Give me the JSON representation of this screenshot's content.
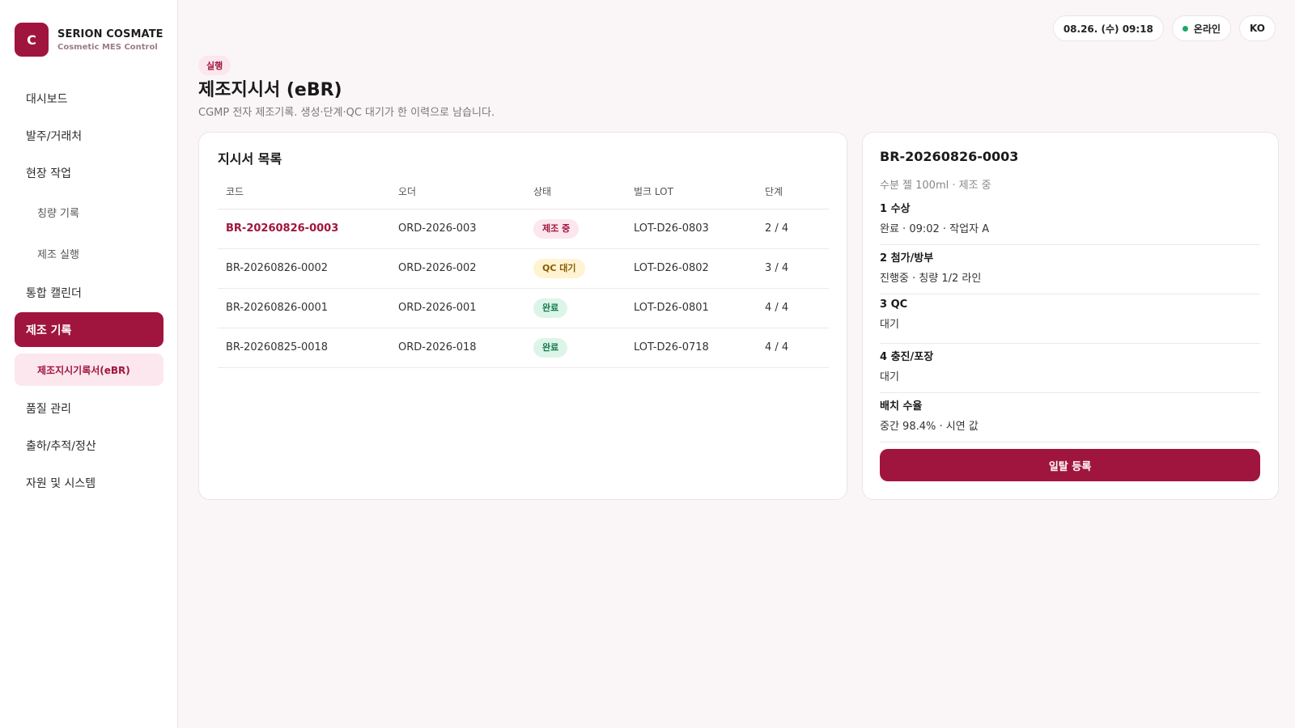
{
  "brand": {
    "logo_letter": "C",
    "name": "SERION COSMATE",
    "sub": "Cosmetic MES Control"
  },
  "sidebar": {
    "items": [
      {
        "label": "대시보드"
      },
      {
        "label": "발주/거래처"
      },
      {
        "label": "현장 작업"
      },
      {
        "label": "칭량 기록"
      },
      {
        "label": "제조 실행"
      },
      {
        "label": "통합 캘린더"
      },
      {
        "label": "제조 기록"
      },
      {
        "label": "제조지시기록서(eBR)"
      },
      {
        "label": "품질 관리"
      },
      {
        "label": "출하/추적/정산"
      },
      {
        "label": "자원 및 시스템"
      }
    ]
  },
  "topbar": {
    "datetime": "08.26. (수) 09:18",
    "status": "온라인",
    "lang": "KO"
  },
  "header": {
    "tag": "실행",
    "title": "제조지시서 (eBR)",
    "subtitle": "CGMP 전자 제조기록. 생성·단계·QC 대기가 한 이력으로 남습니다."
  },
  "list": {
    "title": "지시서 목록",
    "columns": [
      "코드",
      "오더",
      "상태",
      "벌크 LOT",
      "단계"
    ],
    "rows": [
      {
        "code": "BR-20260826-0003",
        "order": "ORD-2026-003",
        "status": "제조 중",
        "lot": "LOT-D26-0803",
        "step": "2 / 4"
      },
      {
        "code": "BR-20260826-0002",
        "order": "ORD-2026-002",
        "status": "QC 대기",
        "lot": "LOT-D26-0802",
        "step": "3 / 4"
      },
      {
        "code": "BR-20260826-0001",
        "order": "ORD-2026-001",
        "status": "완료",
        "lot": "LOT-D26-0801",
        "step": "4 / 4"
      },
      {
        "code": "BR-20260825-0018",
        "order": "ORD-2026-018",
        "status": "완료",
        "lot": "LOT-D26-0718",
        "step": "4 / 4"
      }
    ]
  },
  "detail": {
    "title": "BR-20260826-0003",
    "subtitle": "수분 젤 100ml · 제조 중",
    "steps": [
      {
        "name": "1 수상",
        "desc": "완료 · 09:02 · 작업자 A"
      },
      {
        "name": "2 첨가/방부",
        "desc": "진행중 · 칭량 1/2 라인"
      },
      {
        "name": "3 QC",
        "desc": "대기"
      },
      {
        "name": "4 충진/포장",
        "desc": "대기"
      },
      {
        "name": "배치 수율",
        "desc": "중간 98.4% · 시연 값"
      }
    ],
    "action": "일탈 등록"
  },
  "colors": {
    "accent": "#a0153e",
    "online": "#1fa66a",
    "qc": "#fff3d1",
    "done": "#ddf5e9"
  }
}
